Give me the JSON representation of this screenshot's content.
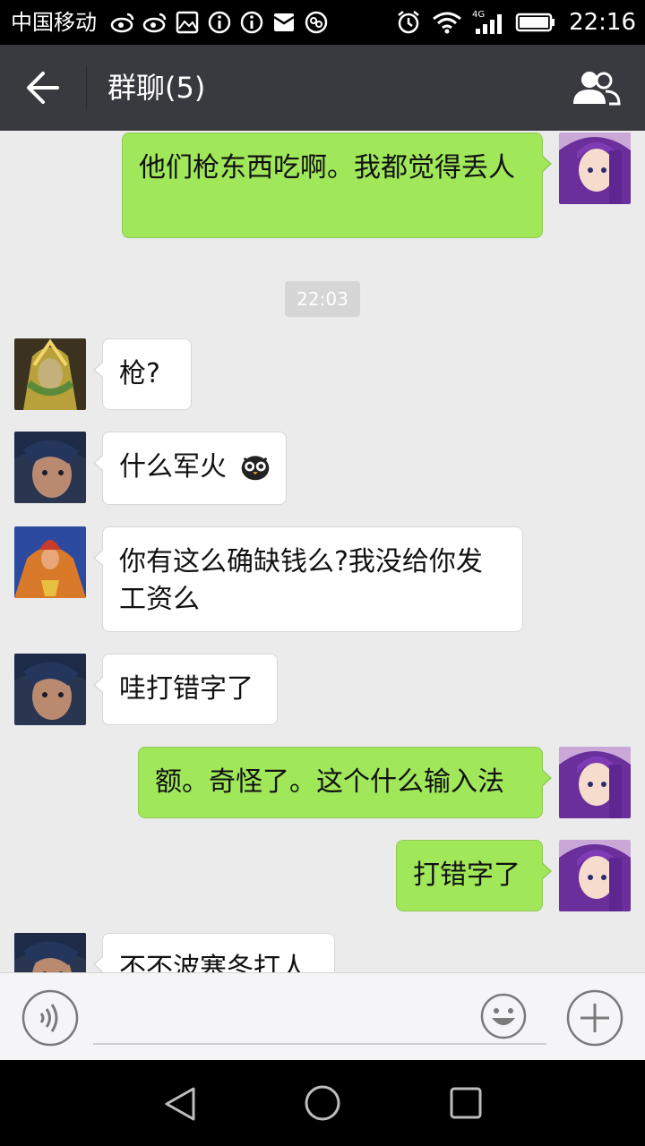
{
  "status_bar": {
    "carrier": "中国移动",
    "network": "4G",
    "time": "22:16",
    "icons": [
      "weibo-icon",
      "weibo-icon",
      "image-icon",
      "info-icon",
      "info-icon",
      "mail-icon",
      "app-icon",
      "alarm-icon",
      "wifi-icon",
      "signal-icon",
      "battery-icon"
    ]
  },
  "header": {
    "title": "群聊(5)",
    "back_icon": "back-arrow-icon",
    "group_icon": "group-members-icon",
    "background": "#393a3f"
  },
  "chat": {
    "timestamp": "22:03",
    "messages": [
      {
        "side": "right",
        "sender_avatar": "purple-hair-avatar",
        "text": "他们枪东西吃啊。我都觉得丢人"
      },
      {
        "side": "left",
        "sender_avatar": "golden-armor-avatar",
        "text": "枪?"
      },
      {
        "side": "left",
        "sender_avatar": "blue-hair-avatar",
        "text": "什么军火",
        "emoji": "owl-emoji"
      },
      {
        "side": "left",
        "sender_avatar": "red-armor-avatar",
        "text": "你有这么确缺钱么?我没给你发工资么"
      },
      {
        "side": "left",
        "sender_avatar": "blue-hair-avatar",
        "text": "哇打错字了"
      },
      {
        "side": "right",
        "sender_avatar": "purple-hair-avatar",
        "text": "额。奇怪了。这个什么输入法"
      },
      {
        "side": "right",
        "sender_avatar": "purple-hair-avatar",
        "text": "打错字了"
      },
      {
        "side": "left",
        "sender_avatar": "blue-hair-avatar",
        "text": "不不波塞冬打人"
      }
    ],
    "colors": {
      "right_bubble": "#a0e75a",
      "left_bubble": "#ffffff",
      "background": "#ebebeb"
    }
  },
  "input_bar": {
    "voice_icon": "voice-icon",
    "emoji_icon": "smiley-icon",
    "plus_icon": "plus-icon",
    "value": ""
  },
  "nav_bar": {
    "icons": [
      "nav-back-icon",
      "nav-home-icon",
      "nav-recent-icon"
    ]
  }
}
